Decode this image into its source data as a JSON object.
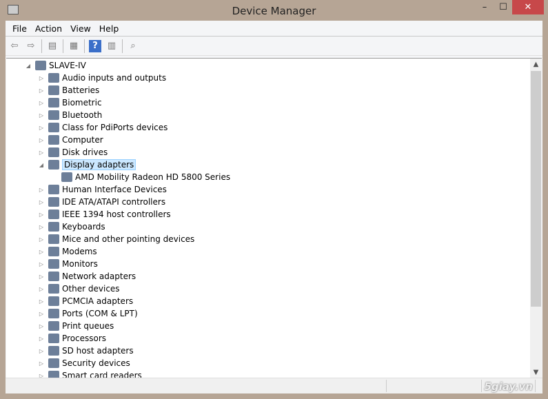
{
  "window": {
    "title": "Device Manager",
    "minimize": "–",
    "maximize": "☐",
    "close": "✕"
  },
  "menu": [
    "File",
    "Action",
    "View",
    "Help"
  ],
  "toolbar": [
    {
      "icon": "back-arrow-icon",
      "glyph": "⇦"
    },
    {
      "icon": "forward-arrow-icon",
      "glyph": "⇨"
    },
    {
      "icon": "show-hide-console-tree-icon",
      "glyph": "▤"
    },
    {
      "icon": "properties-icon",
      "glyph": "▦"
    },
    {
      "icon": "help-icon",
      "glyph": "?"
    },
    {
      "icon": "action-pane-icon",
      "glyph": "▥"
    },
    {
      "icon": "scan-hardware-icon",
      "glyph": "⌕"
    }
  ],
  "tree": {
    "root": "SLAVE-IV",
    "items": [
      {
        "label": "Audio inputs and outputs",
        "icon": "speaker-icon"
      },
      {
        "label": "Batteries",
        "icon": "battery-icon"
      },
      {
        "label": "Biometric",
        "icon": "fingerprint-icon"
      },
      {
        "label": "Bluetooth",
        "icon": "bluetooth-icon"
      },
      {
        "label": "Class for PdiPorts devices",
        "icon": "device-class-icon"
      },
      {
        "label": "Computer",
        "icon": "computer-icon"
      },
      {
        "label": "Disk drives",
        "icon": "disk-drive-icon"
      },
      {
        "label": "Display adapters",
        "icon": "display-adapter-icon",
        "expanded": true,
        "selected": true,
        "children": [
          "AMD Mobility Radeon HD 5800 Series"
        ]
      },
      {
        "label": "Human Interface Devices",
        "icon": "hid-icon"
      },
      {
        "label": "IDE ATA/ATAPI controllers",
        "icon": "ide-controller-icon"
      },
      {
        "label": "IEEE 1394 host controllers",
        "icon": "ieee1394-icon"
      },
      {
        "label": "Keyboards",
        "icon": "keyboard-icon"
      },
      {
        "label": "Mice and other pointing devices",
        "icon": "mouse-icon"
      },
      {
        "label": "Modems",
        "icon": "modem-icon"
      },
      {
        "label": "Monitors",
        "icon": "monitor-icon"
      },
      {
        "label": "Network adapters",
        "icon": "network-adapter-icon"
      },
      {
        "label": "Other devices",
        "icon": "unknown-device-icon"
      },
      {
        "label": "PCMCIA adapters",
        "icon": "pcmcia-icon"
      },
      {
        "label": "Ports (COM & LPT)",
        "icon": "port-icon"
      },
      {
        "label": "Print queues",
        "icon": "printer-icon"
      },
      {
        "label": "Processors",
        "icon": "processor-icon"
      },
      {
        "label": "SD host adapters",
        "icon": "sd-card-icon"
      },
      {
        "label": "Security devices",
        "icon": "security-key-icon"
      },
      {
        "label": "Smart card readers",
        "icon": "smart-card-icon"
      }
    ]
  },
  "watermark": "5giay.vn"
}
